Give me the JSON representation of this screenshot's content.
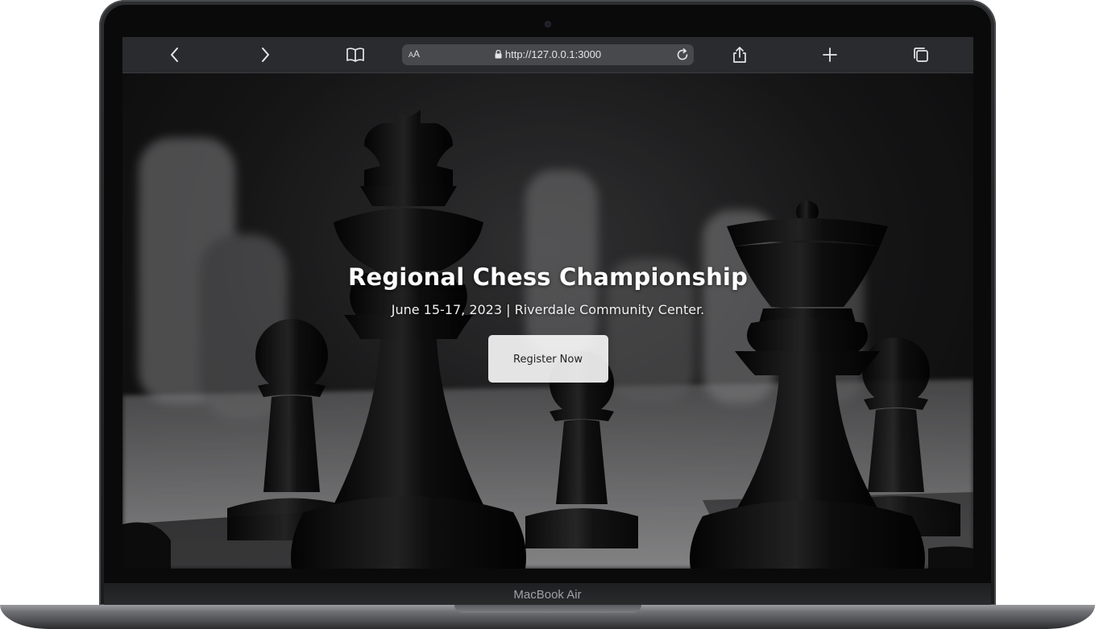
{
  "device": {
    "label": "MacBook Air"
  },
  "browser": {
    "reader_label": "AA",
    "url": "http://127.0.0.1:3000"
  },
  "hero": {
    "title": "Regional Chess Championship",
    "subtitle": "June 15-17, 2023 | Riverdale Community Center.",
    "cta_label": "Register Now"
  },
  "icons": {
    "back": "chevron-left-icon",
    "forward": "chevron-right-icon",
    "bookmarks": "book-icon",
    "lock": "lock-icon",
    "reload": "reload-icon",
    "share": "share-icon",
    "new_tab": "plus-icon",
    "tabs": "tabs-icon"
  },
  "colors": {
    "toolbar": "#2a2b2e",
    "address_bar": "#48494c",
    "cta_background": "#e0e0e0",
    "hero_text": "#ffffff"
  }
}
